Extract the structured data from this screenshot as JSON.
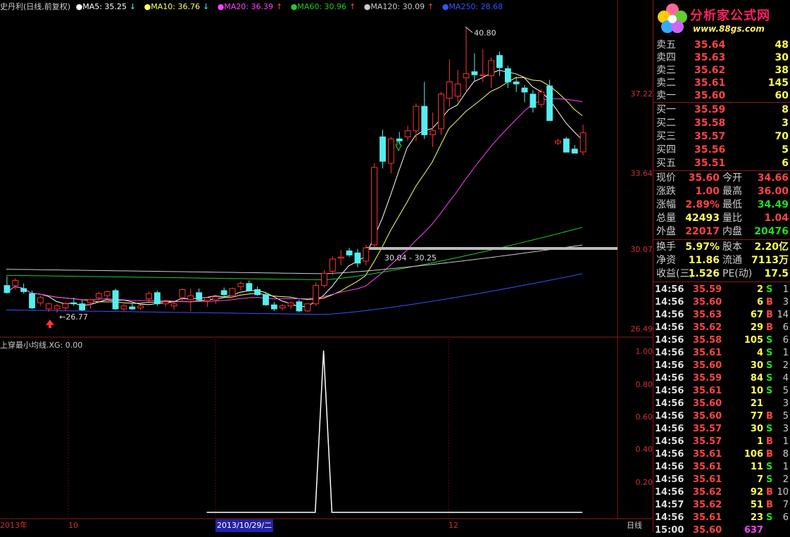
{
  "header": {
    "stock": "史丹利(日线,前复权)",
    "ma": [
      {
        "label": "MA5: 35.25",
        "arrow": "↓",
        "color": "#ffffff"
      },
      {
        "label": "MA10: 36.76",
        "arrow": "↓",
        "color": "#ffff66"
      },
      {
        "label": "MA20: 36.39",
        "arrow": "↑",
        "color": "#ff44ff"
      },
      {
        "label": "MA60: 30.96",
        "arrow": "↑",
        "color": "#22cc22"
      },
      {
        "label": "MA120: 30.09",
        "arrow": "↑",
        "color": "#cccccc"
      },
      {
        "label": "MA250: 28.68",
        "arrow": "",
        "color": "#3355ff"
      }
    ]
  },
  "price_axis": [
    "37.22",
    "33.64",
    "30.07",
    "26.49"
  ],
  "annotations": {
    "high": "40.80",
    "low": "26.77",
    "level": "30.04 - 30.25"
  },
  "indicator": {
    "title": "上穿最小均线.XG: 0.00",
    "axis": [
      "1.00",
      "0.80",
      "0.60",
      "0.40",
      "0.20"
    ]
  },
  "dates": [
    "2013年",
    "10",
    "2013/10/29/二",
    "12"
  ],
  "period_label": "日线",
  "logo": {
    "title": "分析家公式网",
    "url": "www.88gs.com"
  },
  "orderbook": {
    "asks": [
      {
        "label": "卖五",
        "price": "35.64",
        "vol": "48"
      },
      {
        "label": "卖四",
        "price": "35.63",
        "vol": "30"
      },
      {
        "label": "卖三",
        "price": "35.62",
        "vol": "38"
      },
      {
        "label": "卖二",
        "price": "35.61",
        "vol": "145"
      },
      {
        "label": "卖一",
        "price": "35.60",
        "vol": "60"
      }
    ],
    "bids": [
      {
        "label": "买一",
        "price": "35.59",
        "vol": "8"
      },
      {
        "label": "买二",
        "price": "35.58",
        "vol": "3"
      },
      {
        "label": "买三",
        "price": "35.57",
        "vol": "70"
      },
      {
        "label": "买四",
        "price": "35.56",
        "vol": "5"
      },
      {
        "label": "买五",
        "price": "35.51",
        "vol": "6"
      }
    ]
  },
  "quote": [
    {
      "k": "现价",
      "v": "35.60",
      "vc": "#ff4444",
      "k2": "今开",
      "v2": "34.66",
      "v2c": "#ff4444"
    },
    {
      "k": "涨跌",
      "v": "1.00",
      "vc": "#ff4444",
      "k2": "最高",
      "v2": "36.00",
      "v2c": "#ff4444"
    },
    {
      "k": "涨幅",
      "v": "2.89%",
      "vc": "#ff4444",
      "k2": "最低",
      "v2": "34.49",
      "v2c": "#22dd22"
    },
    {
      "k": "总量",
      "v": "42493",
      "vc": "#ffff55",
      "k2": "量比",
      "v2": "1.04",
      "v2c": "#ff4444"
    },
    {
      "k": "外盘",
      "v": "22017",
      "vc": "#ff4444",
      "k2": "内盘",
      "v2": "20476",
      "v2c": "#22dd22"
    },
    {
      "k": "换手",
      "v": "5.97%",
      "vc": "#ffff55",
      "k2": "股本",
      "v2": "2.20亿",
      "v2c": "#ffff55"
    },
    {
      "k": "净资",
      "v": "11.86",
      "vc": "#ffff55",
      "k2": "流通",
      "v2": "7113万",
      "v2c": "#ffff55"
    },
    {
      "k": "收益(三)",
      "v": "1.526",
      "vc": "#ffff55",
      "k2": "PE(动)",
      "v2": "17.5",
      "v2c": "#ffff55"
    }
  ],
  "ticks": [
    {
      "t": "14:56",
      "p": "35.59",
      "v": "2",
      "s": "S",
      "c": "1"
    },
    {
      "t": "14:56",
      "p": "35.60",
      "v": "6",
      "s": "B",
      "c": "3"
    },
    {
      "t": "14:56",
      "p": "35.63",
      "v": "67",
      "s": "B",
      "c": "14"
    },
    {
      "t": "14:56",
      "p": "35.62",
      "v": "29",
      "s": "B",
      "c": "6"
    },
    {
      "t": "14:56",
      "p": "35.58",
      "v": "105",
      "s": "S",
      "c": "6"
    },
    {
      "t": "14:56",
      "p": "35.61",
      "v": "4",
      "s": "S",
      "c": "1"
    },
    {
      "t": "14:56",
      "p": "35.60",
      "v": "30",
      "s": "S",
      "c": "2"
    },
    {
      "t": "14:56",
      "p": "35.59",
      "v": "84",
      "s": "S",
      "c": "4"
    },
    {
      "t": "14:56",
      "p": "35.61",
      "v": "10",
      "s": "S",
      "c": "5"
    },
    {
      "t": "14:56",
      "p": "35.60",
      "v": "21",
      "s": "",
      "c": "3"
    },
    {
      "t": "14:56",
      "p": "35.60",
      "v": "77",
      "s": "B",
      "c": "5"
    },
    {
      "t": "14:56",
      "p": "35.57",
      "v": "30",
      "s": "S",
      "c": "3"
    },
    {
      "t": "14:56",
      "p": "35.57",
      "v": "1",
      "s": "B",
      "c": "1"
    },
    {
      "t": "14:56",
      "p": "35.61",
      "v": "106",
      "s": "B",
      "c": "8"
    },
    {
      "t": "14:56",
      "p": "35.61",
      "v": "11",
      "s": "S",
      "c": "1"
    },
    {
      "t": "14:56",
      "p": "35.61",
      "v": "7",
      "s": "S",
      "c": "2"
    },
    {
      "t": "14:56",
      "p": "35.62",
      "v": "92",
      "s": "B",
      "c": "10"
    },
    {
      "t": "14:57",
      "p": "35.62",
      "v": "51",
      "s": "B",
      "c": "7"
    },
    {
      "t": "14:56",
      "p": "35.61",
      "v": "23",
      "s": "S",
      "c": "6"
    },
    {
      "t": "15:00",
      "p": "35.60",
      "v": "637",
      "s": "",
      "c": ""
    }
  ],
  "colors": {
    "up": "#ff3333",
    "down": "#55eeee",
    "grid": "#8b1a1a",
    "sell": "#22dd22",
    "buy": "#ff4444"
  },
  "chart_data": {
    "type": "candlestick",
    "price_range": [
      25.6,
      41.5
    ],
    "candles": [
      {
        "o": 28.1,
        "h": 28.55,
        "l": 27.7,
        "c": 27.75
      },
      {
        "o": 28.1,
        "h": 28.45,
        "l": 27.9,
        "c": 28.35
      },
      {
        "o": 27.95,
        "h": 28.2,
        "l": 27.7,
        "c": 27.8
      },
      {
        "o": 27.7,
        "h": 27.85,
        "l": 26.95,
        "c": 27.0
      },
      {
        "o": 27.25,
        "h": 27.6,
        "l": 27.1,
        "c": 27.5
      },
      {
        "o": 26.95,
        "h": 27.25,
        "l": 26.8,
        "c": 27.2
      },
      {
        "o": 26.95,
        "h": 27.2,
        "l": 26.77,
        "c": 27.1
      },
      {
        "o": 27.0,
        "h": 27.3,
        "l": 26.85,
        "c": 27.2
      },
      {
        "o": 27.25,
        "h": 27.5,
        "l": 27.1,
        "c": 27.2
      },
      {
        "o": 27.2,
        "h": 27.4,
        "l": 26.85,
        "c": 26.9
      },
      {
        "o": 27.25,
        "h": 27.45,
        "l": 26.95,
        "c": 27.4
      },
      {
        "o": 27.5,
        "h": 27.8,
        "l": 27.35,
        "c": 27.7
      },
      {
        "o": 27.6,
        "h": 27.85,
        "l": 27.45,
        "c": 27.8
      },
      {
        "o": 27.85,
        "h": 27.95,
        "l": 26.9,
        "c": 26.95
      },
      {
        "o": 26.95,
        "h": 27.2,
        "l": 26.85,
        "c": 27.1
      },
      {
        "o": 27.05,
        "h": 27.25,
        "l": 26.9,
        "c": 26.95
      },
      {
        "o": 27.0,
        "h": 27.15,
        "l": 26.9,
        "c": 27.1
      },
      {
        "o": 27.45,
        "h": 27.8,
        "l": 27.3,
        "c": 27.7
      },
      {
        "o": 27.75,
        "h": 27.85,
        "l": 27.1,
        "c": 27.2
      },
      {
        "o": 27.2,
        "h": 27.4,
        "l": 27.05,
        "c": 27.3
      },
      {
        "o": 27.1,
        "h": 27.3,
        "l": 26.9,
        "c": 27.2
      },
      {
        "o": 27.5,
        "h": 27.95,
        "l": 27.3,
        "c": 27.9
      },
      {
        "o": 27.4,
        "h": 27.95,
        "l": 26.85,
        "c": 27.6
      },
      {
        "o": 27.75,
        "h": 27.95,
        "l": 27.35,
        "c": 27.4
      },
      {
        "o": 27.35,
        "h": 27.55,
        "l": 27.05,
        "c": 27.5
      },
      {
        "o": 27.4,
        "h": 27.65,
        "l": 27.2,
        "c": 27.55
      },
      {
        "o": 27.85,
        "h": 28.0,
        "l": 27.5,
        "c": 27.65
      },
      {
        "o": 27.6,
        "h": 28.0,
        "l": 27.5,
        "c": 27.95
      },
      {
        "o": 28.05,
        "h": 28.3,
        "l": 27.85,
        "c": 28.2
      },
      {
        "o": 28.2,
        "h": 28.35,
        "l": 27.8,
        "c": 27.85
      },
      {
        "o": 27.9,
        "h": 28.05,
        "l": 27.6,
        "c": 27.65
      },
      {
        "o": 27.65,
        "h": 27.75,
        "l": 27.1,
        "c": 27.15
      },
      {
        "o": 27.15,
        "h": 27.3,
        "l": 26.85,
        "c": 26.95
      },
      {
        "o": 27.0,
        "h": 27.2,
        "l": 26.85,
        "c": 27.1
      },
      {
        "o": 27.1,
        "h": 27.3,
        "l": 26.95,
        "c": 27.25
      },
      {
        "o": 27.3,
        "h": 27.4,
        "l": 26.8,
        "c": 26.85
      },
      {
        "o": 26.85,
        "h": 27.2,
        "l": 26.8,
        "c": 27.2
      },
      {
        "o": 27.2,
        "h": 28.25,
        "l": 27.1,
        "c": 28.1
      },
      {
        "o": 28.1,
        "h": 28.85,
        "l": 28.0,
        "c": 28.7
      },
      {
        "o": 28.8,
        "h": 29.55,
        "l": 28.6,
        "c": 29.4
      },
      {
        "o": 29.45,
        "h": 29.85,
        "l": 29.1,
        "c": 29.5
      },
      {
        "o": 29.8,
        "h": 29.95,
        "l": 29.5,
        "c": 29.6
      },
      {
        "o": 29.7,
        "h": 29.9,
        "l": 29.0,
        "c": 29.2
      },
      {
        "o": 29.3,
        "h": 30.1,
        "l": 29.1,
        "c": 29.95
      },
      {
        "o": 30.1,
        "h": 34.1,
        "l": 30.0,
        "c": 33.9
      },
      {
        "o": 35.4,
        "h": 35.75,
        "l": 33.85,
        "c": 34.2
      },
      {
        "o": 34.1,
        "h": 35.4,
        "l": 33.6,
        "c": 35.3
      },
      {
        "o": 35.3,
        "h": 35.65,
        "l": 35.05,
        "c": 35.2
      },
      {
        "o": 35.4,
        "h": 35.95,
        "l": 35.2,
        "c": 35.7
      },
      {
        "o": 35.7,
        "h": 37.05,
        "l": 35.2,
        "c": 36.9
      },
      {
        "o": 36.9,
        "h": 38.1,
        "l": 35.3,
        "c": 35.5
      },
      {
        "o": 35.5,
        "h": 36.6,
        "l": 34.9,
        "c": 35.7
      },
      {
        "o": 35.8,
        "h": 37.6,
        "l": 35.5,
        "c": 37.5
      },
      {
        "o": 37.3,
        "h": 39.2,
        "l": 36.9,
        "c": 38.1
      },
      {
        "o": 37.4,
        "h": 38.7,
        "l": 37.1,
        "c": 38.0
      },
      {
        "o": 38.3,
        "h": 40.8,
        "l": 37.6,
        "c": 38.5
      },
      {
        "o": 38.6,
        "h": 39.5,
        "l": 38.1,
        "c": 38.45
      },
      {
        "o": 38.4,
        "h": 39.7,
        "l": 38.1,
        "c": 38.45
      },
      {
        "o": 38.4,
        "h": 39.3,
        "l": 37.8,
        "c": 39.15
      },
      {
        "o": 39.4,
        "h": 39.6,
        "l": 38.4,
        "c": 38.8
      },
      {
        "o": 38.75,
        "h": 38.9,
        "l": 37.8,
        "c": 38.1
      },
      {
        "o": 38.1,
        "h": 38.35,
        "l": 37.6,
        "c": 38.0
      },
      {
        "o": 37.8,
        "h": 37.95,
        "l": 37.1,
        "c": 37.6
      },
      {
        "o": 37.5,
        "h": 37.7,
        "l": 36.6,
        "c": 36.85
      },
      {
        "o": 37.0,
        "h": 37.75,
        "l": 36.85,
        "c": 37.6
      },
      {
        "o": 37.9,
        "h": 38.2,
        "l": 36.9,
        "c": 36.2
      },
      {
        "o": 35.1,
        "h": 35.3,
        "l": 35.0,
        "c": 35.2
      },
      {
        "o": 35.3,
        "h": 35.4,
        "l": 34.65,
        "c": 34.65
      },
      {
        "o": 34.8,
        "h": 35.0,
        "l": 34.6,
        "c": 34.6
      },
      {
        "o": 34.66,
        "h": 36.0,
        "l": 34.49,
        "c": 35.6
      }
    ],
    "signal_values": [
      0,
      0,
      0,
      0,
      0,
      0,
      0,
      0,
      0,
      0,
      0,
      0,
      0,
      0,
      0,
      0,
      0,
      0,
      0,
      0,
      0,
      0,
      0,
      0,
      0,
      0,
      0,
      0,
      0,
      0,
      0,
      0,
      0,
      0,
      0,
      0,
      0,
      0,
      1,
      0,
      0,
      0,
      0,
      0,
      0,
      0,
      0,
      0,
      0,
      0,
      0,
      0,
      0,
      0,
      0,
      0,
      0,
      0,
      0,
      0,
      0,
      0,
      0,
      0,
      0,
      0,
      0,
      0,
      0,
      0
    ],
    "signal_range": [
      0,
      1
    ]
  }
}
